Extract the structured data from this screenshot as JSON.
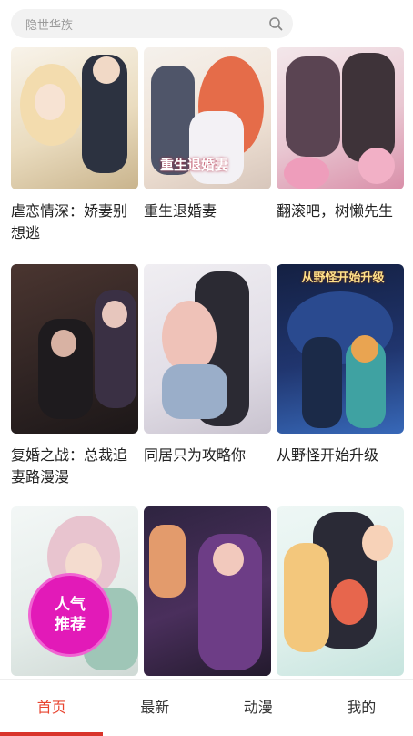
{
  "search": {
    "placeholder": "隐世华族",
    "icon": "search-icon"
  },
  "comics": [
    {
      "title": "虐恋情深：娇妻别想逃",
      "colors": [
        "#f6efe4",
        "#e9d9b8",
        "#2c3240"
      ]
    },
    {
      "title": "重生退婚妻",
      "colors": [
        "#f4efe9",
        "#e36b4a",
        "#5a6072"
      ],
      "logo": "重生退婚妻"
    },
    {
      "title": "翻滚吧，树懒先生",
      "colors": [
        "#f1dfe5",
        "#d58aa6",
        "#4a3a44"
      ]
    },
    {
      "title": "复婚之战：总裁追妻路漫漫",
      "colors": [
        "#3b2a26",
        "#caa394",
        "#1d1a1c"
      ]
    },
    {
      "title": "同居只为攻略你",
      "colors": [
        "#e7e4ea",
        "#efc2b8",
        "#2b2a33"
      ]
    },
    {
      "title": "从野怪开始升级",
      "colors": [
        "#1c2950",
        "#3d6ec1",
        "#f0b545"
      ],
      "logo": "从野怪开始升级"
    },
    {
      "title": "",
      "colors": [
        "#eef3f2",
        "#c9b3c7",
        "#7cb6a5"
      ],
      "badge": [
        "人气",
        "推荐"
      ]
    },
    {
      "title": "",
      "colors": [
        "#3a2b45",
        "#8c4c8a",
        "#e7a3b7"
      ]
    },
    {
      "title": "",
      "colors": [
        "#e8f2f0",
        "#f3c7a6",
        "#2a2a36"
      ]
    }
  ],
  "tabbar": {
    "items": [
      "首页",
      "最新",
      "动漫",
      "我的"
    ],
    "active_index": 0,
    "accent_color": "#e8442f"
  }
}
